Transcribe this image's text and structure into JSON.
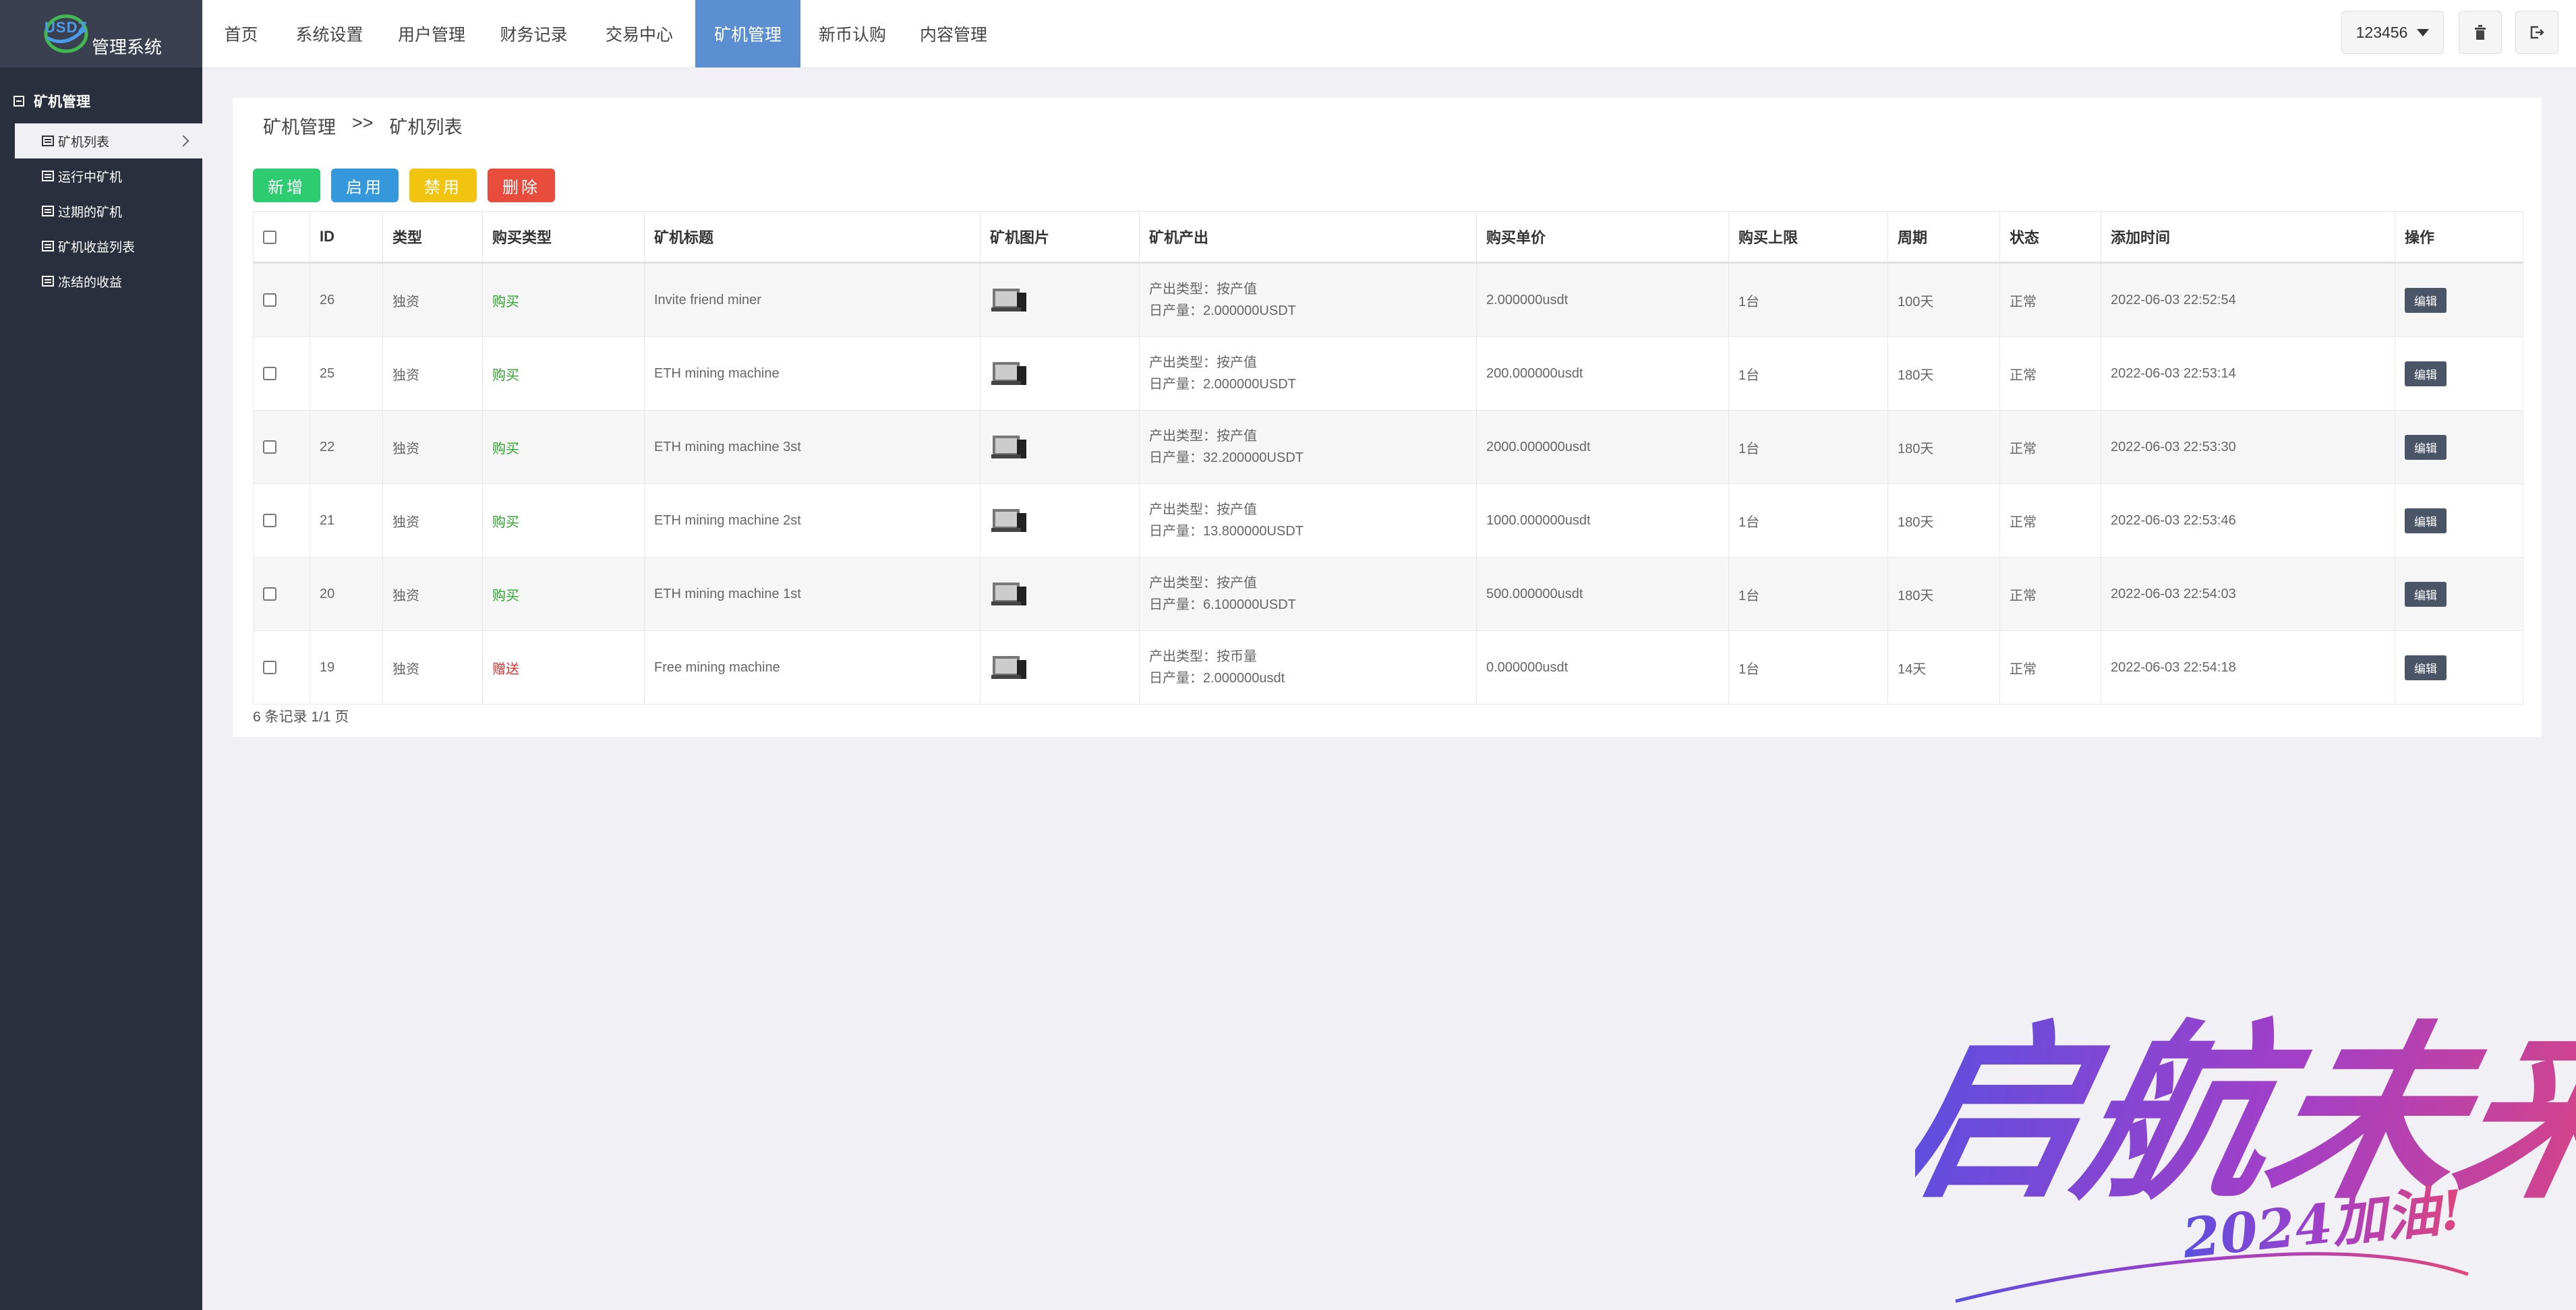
{
  "app": {
    "logo_abbr": "USDZ",
    "title": "管理系统"
  },
  "sidebar": {
    "section": "矿机管理",
    "items": [
      {
        "label": "矿机列表",
        "active": true
      },
      {
        "label": "运行中矿机",
        "active": false
      },
      {
        "label": "过期的矿机",
        "active": false
      },
      {
        "label": "矿机收益列表",
        "active": false
      },
      {
        "label": "冻结的收益",
        "active": false
      }
    ]
  },
  "topnav": {
    "items": [
      "首页",
      "系统设置",
      "用户管理",
      "财务记录",
      "交易中心",
      "矿机管理",
      "新币认购",
      "内容管理"
    ],
    "active_index": 5,
    "user": "123456"
  },
  "breadcrumb": {
    "parent": "矿机管理",
    "sep": ">>",
    "current": "矿机列表"
  },
  "toolbar": {
    "add": "新增",
    "enable": "启用",
    "disable": "禁用",
    "delete": "删除"
  },
  "table": {
    "headers": [
      "ID",
      "类型",
      "购买类型",
      "矿机标题",
      "矿机图片",
      "矿机产出",
      "购买单价",
      "购买上限",
      "周期",
      "状态",
      "添加时间",
      "操作"
    ],
    "rows": [
      {
        "id": "26",
        "type": "独资",
        "buy_type": "购买",
        "buy_kind": "buy",
        "title": "Invite friend miner",
        "out_type": "产出类型：按产值",
        "daily": "日产量：2.000000USDT",
        "price": "2.000000usdt",
        "limit": "1台",
        "cycle": "100天",
        "status": "正常",
        "time": "2022-06-03 22:52:54",
        "action": "编辑"
      },
      {
        "id": "25",
        "type": "独资",
        "buy_type": "购买",
        "buy_kind": "buy",
        "title": "ETH mining machine",
        "out_type": "产出类型：按产值",
        "daily": "日产量：2.000000USDT",
        "price": "200.000000usdt",
        "limit": "1台",
        "cycle": "180天",
        "status": "正常",
        "time": "2022-06-03 22:53:14",
        "action": "编辑"
      },
      {
        "id": "22",
        "type": "独资",
        "buy_type": "购买",
        "buy_kind": "buy",
        "title": "ETH mining machine 3st",
        "out_type": "产出类型：按产值",
        "daily": "日产量：32.200000USDT",
        "price": "2000.000000usdt",
        "limit": "1台",
        "cycle": "180天",
        "status": "正常",
        "time": "2022-06-03 22:53:30",
        "action": "编辑"
      },
      {
        "id": "21",
        "type": "独资",
        "buy_type": "购买",
        "buy_kind": "buy",
        "title": "ETH mining machine 2st",
        "out_type": "产出类型：按产值",
        "daily": "日产量：13.800000USDT",
        "price": "1000.000000usdt",
        "limit": "1台",
        "cycle": "180天",
        "status": "正常",
        "time": "2022-06-03 22:53:46",
        "action": "编辑"
      },
      {
        "id": "20",
        "type": "独资",
        "buy_type": "购买",
        "buy_kind": "buy",
        "title": "ETH mining machine 1st",
        "out_type": "产出类型：按产值",
        "daily": "日产量：6.100000USDT",
        "price": "500.000000usdt",
        "limit": "1台",
        "cycle": "180天",
        "status": "正常",
        "time": "2022-06-03 22:54:03",
        "action": "编辑"
      },
      {
        "id": "19",
        "type": "独资",
        "buy_type": "赠送",
        "buy_kind": "gift",
        "title": "Free mining machine",
        "out_type": "产出类型：按币量",
        "daily": "日产量：2.000000usdt",
        "price": "0.000000usdt",
        "limit": "1台",
        "cycle": "14天",
        "status": "正常",
        "time": "2022-06-03 22:54:18",
        "action": "编辑"
      }
    ]
  },
  "pager": "6 条记录 1/1 页",
  "watermark": {
    "main": "启航未来",
    "sub": "2024加油!"
  },
  "colors": {
    "sidebar": "#2a2f3e",
    "nav_active": "#5b8fd1",
    "buy": "#2aa52a",
    "gift": "#e03030"
  }
}
